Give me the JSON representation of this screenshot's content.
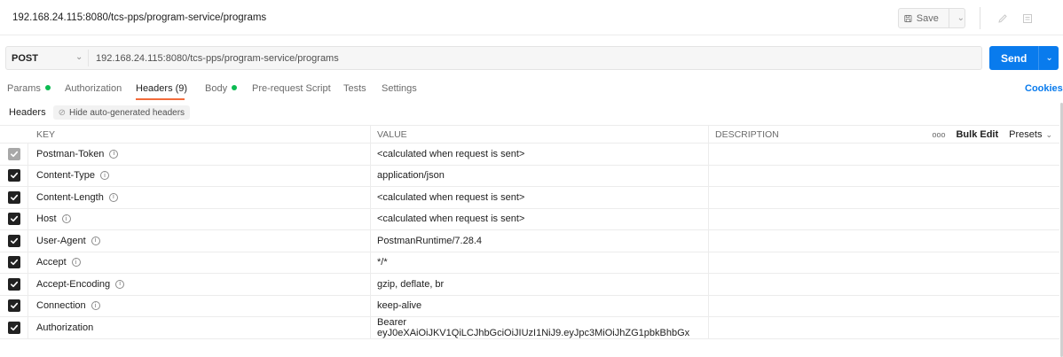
{
  "titlebar": {
    "title": "192.168.24.115:8080/tcs-pps/program-service/programs",
    "save_label": "Save"
  },
  "request": {
    "method": "POST",
    "url": "192.168.24.115:8080/tcs-pps/program-service/programs",
    "send_label": "Send"
  },
  "tabs": {
    "params": "Params",
    "authorization": "Authorization",
    "headers": "Headers (9)",
    "body": "Body",
    "prerequest": "Pre-request Script",
    "tests": "Tests",
    "settings": "Settings",
    "cookies": "Cookies"
  },
  "subbar": {
    "label": "Headers",
    "hide_label": "Hide auto-generated headers"
  },
  "table": {
    "columns": {
      "key": "KEY",
      "value": "VALUE",
      "description": "DESCRIPTION"
    },
    "actions": {
      "more": "ooo",
      "bulk_edit": "Bulk Edit",
      "presets": "Presets"
    },
    "rows": [
      {
        "key": "Postman-Token",
        "value": "<calculated when request is sent>",
        "info": true,
        "disabled": true
      },
      {
        "key": "Content-Type",
        "value": "application/json",
        "info": true,
        "disabled": false
      },
      {
        "key": "Content-Length",
        "value": "<calculated when request is sent>",
        "info": true,
        "disabled": false
      },
      {
        "key": "Host",
        "value": "<calculated when request is sent>",
        "info": true,
        "disabled": false
      },
      {
        "key": "User-Agent",
        "value": "PostmanRuntime/7.28.4",
        "info": true,
        "disabled": false
      },
      {
        "key": "Accept",
        "value": "*/*",
        "info": true,
        "disabled": false
      },
      {
        "key": "Accept-Encoding",
        "value": "gzip, deflate, br",
        "info": true,
        "disabled": false
      },
      {
        "key": "Connection",
        "value": "keep-alive",
        "info": true,
        "disabled": false
      },
      {
        "key": "Authorization",
        "value": "Bearer eyJ0eXAiOiJKV1QiLCJhbGciOiJIUzI1NiJ9.eyJpc3MiOiJhZG1pbkBhbGx",
        "info": false,
        "disabled": false
      }
    ]
  },
  "colors": {
    "accent_blue": "#097bed",
    "active_tab_underline": "#f26b3a",
    "status_dot_green": "#0cbb52"
  }
}
